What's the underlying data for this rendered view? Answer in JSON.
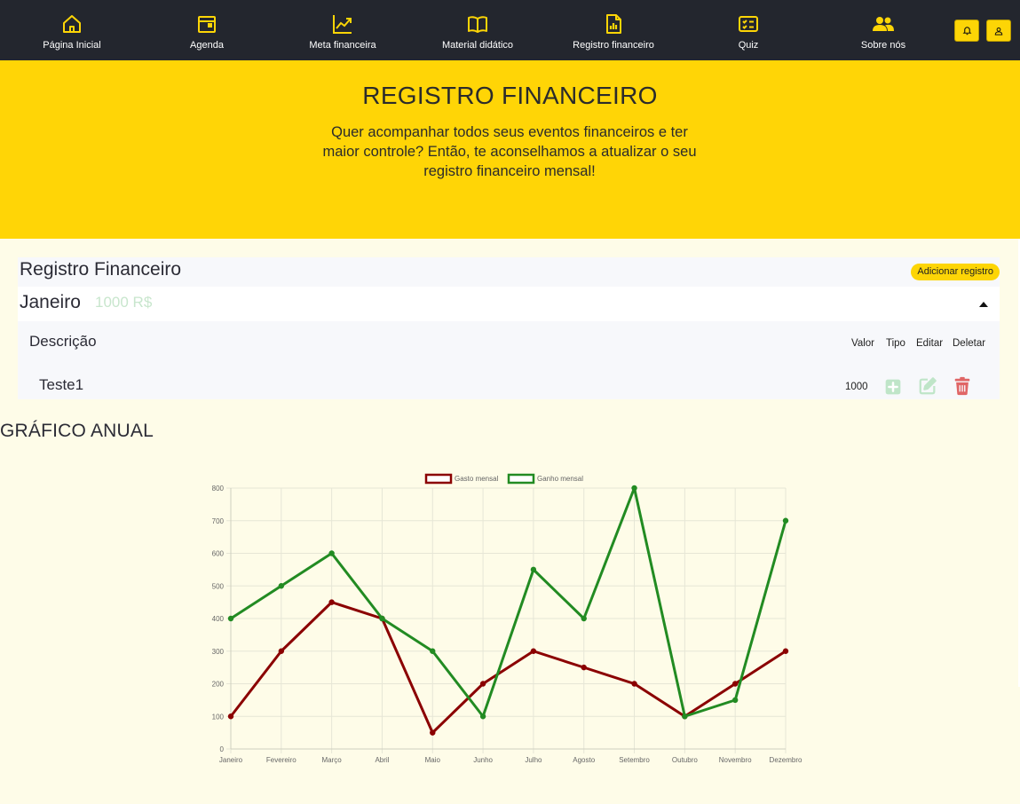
{
  "nav": {
    "items": [
      {
        "label": "Página Inicial",
        "icon": "home-icon"
      },
      {
        "label": "Agenda",
        "icon": "calendar-icon"
      },
      {
        "label": "Meta financeira",
        "icon": "trending-chart-icon"
      },
      {
        "label": "Material didático",
        "icon": "book-icon"
      },
      {
        "label": "Registro financeiro",
        "icon": "report-document-icon"
      },
      {
        "label": "Quiz",
        "icon": "checklist-icon"
      },
      {
        "label": "Sobre nós",
        "icon": "users-icon"
      }
    ],
    "notifications_icon": "bell-icon",
    "profile_icon": "user-icon"
  },
  "hero": {
    "title": "REGISTRO FINANCEIRO",
    "text": "Quer acompanhar todos seus eventos financeiros e ter maior controle? Então, te aconselhamos a atualizar o seu registro financeiro mensal!"
  },
  "register": {
    "title": "Registro Financeiro",
    "add_button": "Adicionar registro",
    "month": "Janeiro",
    "month_total": "1000 R$",
    "columns": {
      "description": "Descrição",
      "value": "Valor",
      "type": "Tipo",
      "edit": "Editar",
      "delete": "Deletar"
    },
    "rows": [
      {
        "description": "Teste1",
        "value": "1000",
        "type_icon": "plus-square-icon",
        "edit_icon": "edit-icon",
        "delete_icon": "trash-icon"
      }
    ]
  },
  "chart_title": "GRÁFICO ANUAL",
  "colors": {
    "nav_bg": "#23262e",
    "accent": "#ffd506",
    "page_bg": "#fefce8",
    "expense": "#8b0000",
    "income": "#228b22"
  },
  "chart_data": {
    "type": "line",
    "categories": [
      "Janeiro",
      "Fevereiro",
      "Março",
      "Abril",
      "Maio",
      "Junho",
      "Julho",
      "Agosto",
      "Setembro",
      "Outubro",
      "Novembro",
      "Dezembro"
    ],
    "series": [
      {
        "name": "Gasto mensal",
        "color": "#8b0000",
        "values": [
          100,
          300,
          450,
          400,
          50,
          200,
          300,
          250,
          200,
          100,
          200,
          300
        ]
      },
      {
        "name": "Ganho mensal",
        "color": "#228b22",
        "values": [
          400,
          500,
          600,
          400,
          300,
          100,
          550,
          400,
          800,
          100,
          150,
          700
        ]
      }
    ],
    "ylim": [
      0,
      800
    ],
    "yticks": [
      0,
      100,
      200,
      300,
      400,
      500,
      600,
      700,
      800
    ],
    "grid": true,
    "legend": "top-center"
  }
}
